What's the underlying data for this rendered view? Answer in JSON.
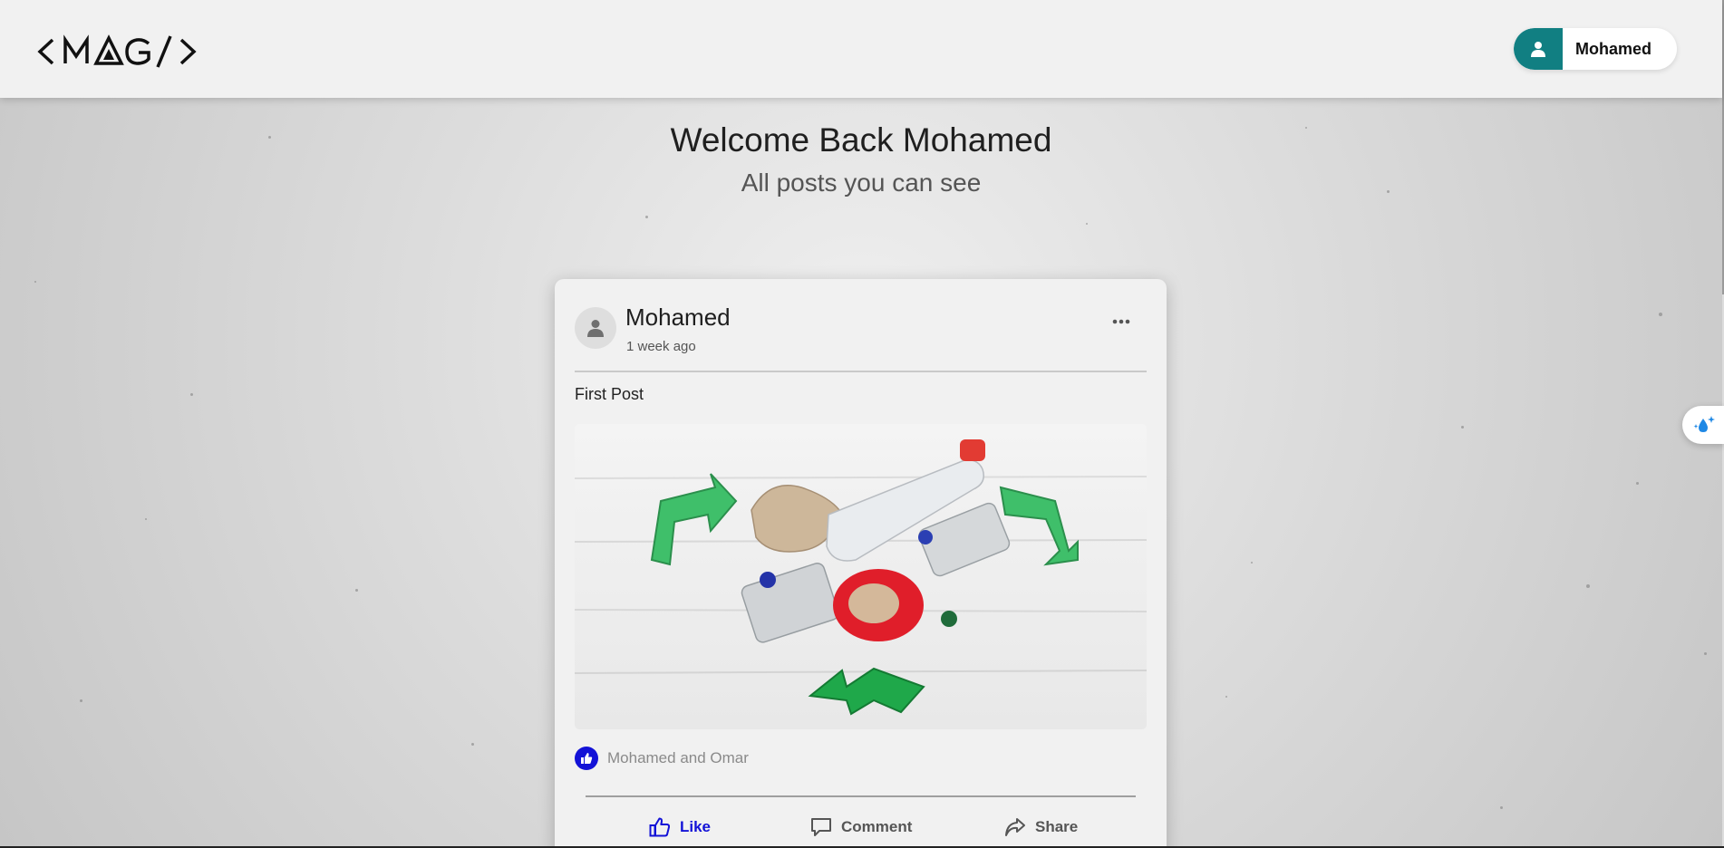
{
  "header": {
    "logo_text": "<MAG/>",
    "user_name": "Mohamed"
  },
  "welcome": {
    "title": "Welcome Back Mohamed",
    "subtitle": "All posts you can see"
  },
  "post": {
    "author": "Mohamed",
    "time": "1 week ago",
    "text": "First Post",
    "image_alt": "recycling-items-image",
    "likes_text": "Mohamed and Omar",
    "actions": {
      "like": "Like",
      "comment": "Comment",
      "share": "Share"
    }
  },
  "colors": {
    "accent_teal": "#117f82",
    "like_blue": "#1312d7",
    "recycle_green": "#3fbf6a"
  },
  "icons": {
    "user": "user-icon",
    "more": "more-options-icon",
    "like": "thumbs-up-icon",
    "comment": "comment-icon",
    "share": "share-icon",
    "side": "water-drop-sparkle-icon"
  }
}
